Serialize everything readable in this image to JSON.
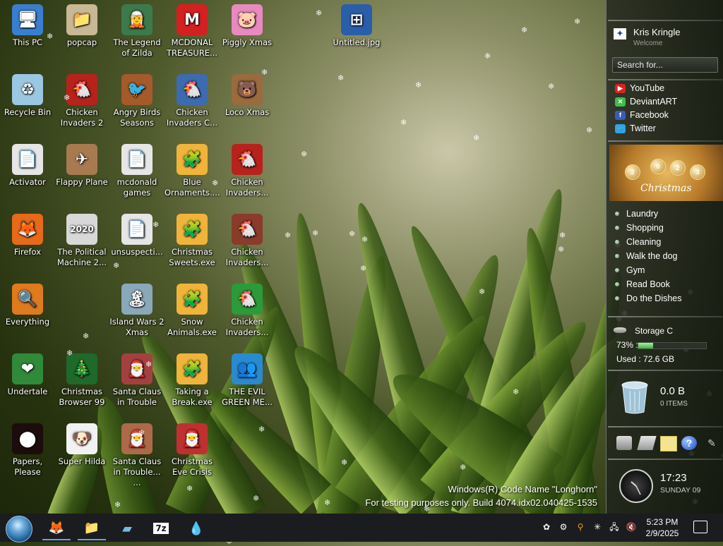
{
  "desktop": {
    "icons": [
      {
        "label": "This PC",
        "glyph": "🖥"
      },
      {
        "label": "popcap",
        "glyph": "📁"
      },
      {
        "label": "The Legend of Zilda",
        "glyph": "🧝"
      },
      {
        "label": "MCDONAL TREASURE...",
        "glyph": "M"
      },
      {
        "label": "Piggly Xmas",
        "glyph": "🐷"
      },
      {
        "label": "Untitled.jpg",
        "glyph": "⊞"
      },
      {
        "label": "Recycle Bin",
        "glyph": "♻"
      },
      {
        "label": "Chicken Invaders 2",
        "glyph": "🐔"
      },
      {
        "label": "Angry Birds Seasons",
        "glyph": "🐦"
      },
      {
        "label": "Chicken Invaders C...",
        "glyph": "🐔"
      },
      {
        "label": "Loco Xmas",
        "glyph": "🐻"
      },
      {
        "label": "Activator",
        "glyph": "📄"
      },
      {
        "label": "Flappy Plane",
        "glyph": "✈"
      },
      {
        "label": "mcdonald games",
        "glyph": "📄"
      },
      {
        "label": "Blue Ornaments....",
        "glyph": "🧩"
      },
      {
        "label": "Chicken Invaders...",
        "glyph": "🐔"
      },
      {
        "label": "Firefox",
        "glyph": "🦊"
      },
      {
        "label": "The Political Machine 2...",
        "glyph": "2020"
      },
      {
        "label": "unsuspecti...",
        "glyph": "📄"
      },
      {
        "label": "Christmas Sweets.exe",
        "glyph": "🧩"
      },
      {
        "label": "Chicken Invaders...",
        "glyph": "🐔"
      },
      {
        "label": "Everything",
        "glyph": "🔍"
      },
      {
        "label": "Island Wars 2 Xmas",
        "glyph": "🏝"
      },
      {
        "label": "Snow Animals.exe",
        "glyph": "🧩"
      },
      {
        "label": "Chicken Invaders...",
        "glyph": "🐔"
      },
      {
        "label": "Undertale",
        "glyph": "❤"
      },
      {
        "label": "Christmas Browser 99",
        "glyph": "🎄"
      },
      {
        "label": "Santa Claus in Trouble",
        "glyph": "🎅"
      },
      {
        "label": "Taking a Break.exe",
        "glyph": "🧩"
      },
      {
        "label": "THE EVIL GREEN ME...",
        "glyph": "👥"
      },
      {
        "label": "Papers, Please",
        "glyph": "⬤"
      },
      {
        "label": "Super Hilda",
        "glyph": "🐶"
      },
      {
        "label": "Santa Claus in Trouble... ...",
        "glyph": "🎅"
      },
      {
        "label": "Christmas Eve Crisis",
        "glyph": "🎅"
      }
    ],
    "watermark_line1": "Windows(R) Code Name \"Longhorn\"",
    "watermark_line2": "For testing purposes only. Build 4074.idx02.040425-1535"
  },
  "sidebar": {
    "user_name": "Kris Kringle",
    "user_sub": "Welcome",
    "search_placeholder": "Search for...",
    "links": [
      {
        "label": "YouTube",
        "color": "#e02020",
        "icon": "youtube-icon"
      },
      {
        "label": "DeviantART",
        "color": "#3fbf4a",
        "icon": "deviantart-icon"
      },
      {
        "label": "Facebook",
        "color": "#3b5bb8",
        "icon": "facebook-icon"
      },
      {
        "label": "Twitter",
        "color": "#2fa3e6",
        "icon": "twitter-icon"
      }
    ],
    "banner_year": [
      "2",
      "0",
      "2",
      "3"
    ],
    "banner_caption": "Christmas",
    "todos": [
      "Laundry",
      "Shopping",
      "Cleaning",
      "Walk the dog",
      "Gym",
      "Read Book",
      "Do the Dishes"
    ],
    "storage": {
      "title": "Storage C",
      "percent_label": "73% :",
      "percent": 0.73,
      "used": "Used : 72.6 GB"
    },
    "recycle": {
      "size": "0.0 B",
      "items": "0 ITEMS"
    },
    "clock": {
      "time": "17:23",
      "day": "SUNDAY 09"
    }
  },
  "taskbar": {
    "apps": [
      {
        "name": "firefox",
        "glyph": "🦊",
        "active": true
      },
      {
        "name": "file-explorer",
        "glyph": "📁",
        "active": true
      },
      {
        "name": "glass-app",
        "glyph": "▰",
        "active": false
      },
      {
        "name": "7zip",
        "glyph": "7z",
        "active": false
      },
      {
        "name": "drop-app",
        "glyph": "💧",
        "active": false
      }
    ],
    "time": "5:23 PM",
    "date": "2/9/2025"
  }
}
